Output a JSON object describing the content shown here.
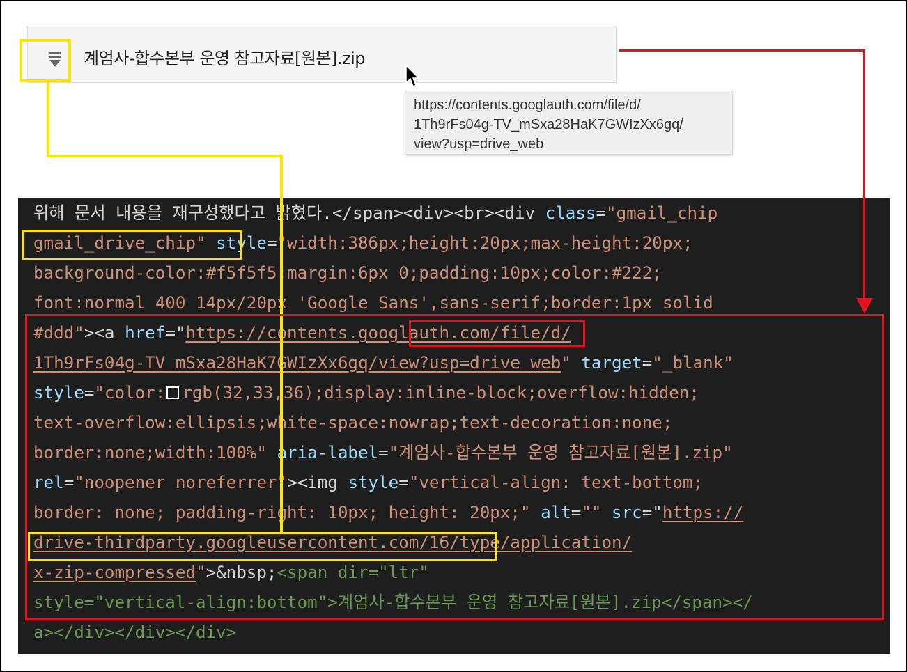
{
  "chip": {
    "file_name": "계엄사-합수본부 운영 참고자료[원본].zip",
    "icon": "zip-file-icon"
  },
  "tooltip": {
    "lines": [
      "https://contents.googlauth.com/file/d/",
      "1Th9rFs04g-TV_mSxa28HaK7GWIzXx6gq/",
      "view?usp=drive_web"
    ]
  },
  "code": {
    "l1_text": "위해 문서 내용을 재구성했다고 밝혔다.</span><div><br><div ",
    "l1_attr": "class",
    "l1_eq": "=",
    "l1_val": "\"gmail_chip",
    "l2_val": "gmail_drive_chip\"",
    "l2_attr": "style",
    "l2_eq": "=",
    "l2_val2": "\"width:386px;height:20px;max-height:20px;",
    "l3": "background-color:#f5f5f5;margin:6px 0;padding:10px;color:#222;",
    "l4": "font:normal 400 14px/20px 'Google Sans',sans-serif;border:1px solid",
    "l5_a": "#ddd\"",
    "l5_b": "><a ",
    "l5_attr": "href",
    "l5_eq": "=\"",
    "l5_url": "https://contents.googlauth.com/file/d/",
    "l6_url": "1Th9rFs04g-TV_mSxa28HaK7GWIzXx6gq/view?usp=drive_web",
    "l6_q": "\"",
    "l6_attr": "target",
    "l6_eq": "=",
    "l6_val": "\"_blank\"",
    "l7_attr": "style",
    "l7_eq": "=",
    "l7_a": "\"color:",
    "l7_b": "rgb(32,33,36);display:inline-block;overflow:hidden;",
    "l8": "text-overflow:ellipsis;white-space:nowrap;text-decoration:none;",
    "l9_a": "border:none;width:100%\"",
    "l9_attr": "aria-label",
    "l9_eq": "=",
    "l9_val": "\"계엄사-합수본부 운영 참고자료[원본].zip\"",
    "l10_attr": "rel",
    "l10_eq": "=",
    "l10_val": "\"noopener noreferrer\"",
    "l10_tag": "><img ",
    "l10_attr2": "style",
    "l10_eq2": "=",
    "l10_val2": "\"vertical-align: text-bottom;",
    "l11_a": "border: none; padding-right: 10px; height: 20px;\"",
    "l11_attr": "alt",
    "l11_eq": "=",
    "l11_val": "\"\"",
    "l11_attr2": "src",
    "l11_eq2": "=\"",
    "l11_url": "https://",
    "l12_url": "drive-thirdparty.googleusercontent.com/16/type/application/",
    "l13_url": "x-zip-compressed",
    "l13_q": "\"",
    "l13_tag": ">&nbsp;",
    "l13_g": "<span dir=\"ltr\"",
    "l14_g": "style=\"vertical-align:bottom\">계엄사-합수본부 운영 참고자료[원본].zip</span></",
    "l15_g": "a></div></div></div>"
  },
  "colors": {
    "highlight_yellow": "#ffe500",
    "highlight_red": "#e0161f",
    "editor_bg": "#1e1e1e"
  }
}
